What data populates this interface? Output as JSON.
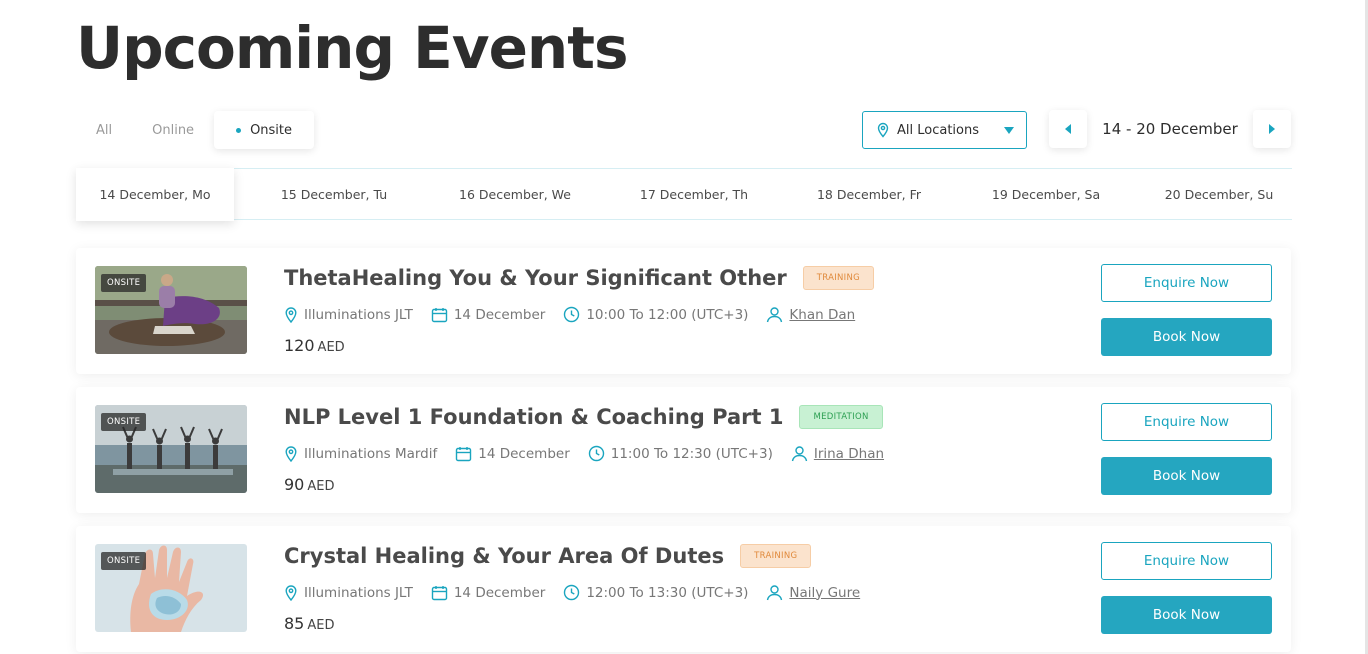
{
  "page": {
    "title": "Upcoming Events"
  },
  "filters": {
    "all": "All",
    "online": "Online",
    "onsite": "Onsite"
  },
  "location": {
    "label": "All Locations"
  },
  "week": {
    "range": "14 - 20 December"
  },
  "days": [
    "14 December, Mo",
    "15 December, Tu",
    "16 December, We",
    "17 December, Th",
    "18 December, Fr",
    "19 December, Sa",
    "20 December, Su"
  ],
  "events": [
    {
      "badge": "ONSITE",
      "title": "ThetaHealing You & Your Significant Other",
      "tag": "TRAINING",
      "location": "Illuminations JLT",
      "date": "14 December",
      "time": "10:00 To 12:00 (UTC+3)",
      "host": "Khan Dan",
      "price": "120",
      "currency": "AED",
      "enquire_label": "Enquire Now",
      "book_label": "Book Now"
    },
    {
      "badge": "ONSITE",
      "title": "NLP Level 1 Foundation & Coaching Part 1",
      "tag": "MEDITATION",
      "location": "Illuminations Mardif",
      "date": "14 December",
      "time": "11:00 To 12:30 (UTC+3)",
      "host": "Irina Dhan",
      "price": "90",
      "currency": "AED",
      "enquire_label": "Enquire Now",
      "book_label": "Book Now"
    },
    {
      "badge": "ONSITE",
      "title": "Crystal Healing & Your Area Of Dutes",
      "tag": "TRAINING",
      "location": "Illuminations JLT",
      "date": "14 December",
      "time": "12:00 To 13:30 (UTC+3)",
      "host": "Naily Gure",
      "price": "85",
      "currency": "AED",
      "enquire_label": "Enquire Now",
      "book_label": "Book Now"
    }
  ],
  "colors": {
    "accent": "#1aa5bf",
    "training": "#e08a3c",
    "meditation": "#2d9f52"
  }
}
